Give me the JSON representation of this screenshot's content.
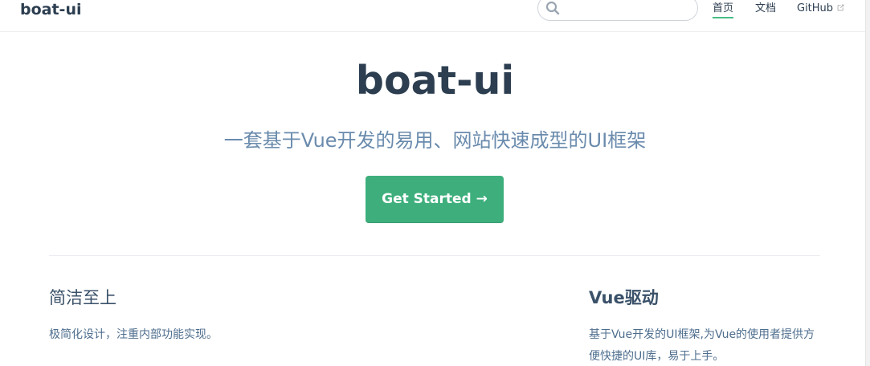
{
  "navbar": {
    "site_name": "boat-ui",
    "search": {
      "placeholder": "",
      "value": ""
    },
    "links": [
      {
        "label": "首页",
        "active": true
      },
      {
        "label": "文档",
        "active": false
      },
      {
        "label": "GitHub",
        "active": false,
        "external": true
      }
    ]
  },
  "hero": {
    "title": "boat-ui",
    "description": "一套基于Vue开发的易用、网站快速成型的UI框架",
    "action_label": "Get Started →"
  },
  "features": [
    {
      "title": "简洁至上",
      "details": "极简化设计，注重内部功能实现。"
    },
    {
      "title": "Vue驱动",
      "details": "基于Vue开发的UI框架,为Vue的使用者提供方便快捷的UI库，易于上手。"
    }
  ],
  "colors": {
    "accent": "#3eaf7c",
    "text": "#2c3e50",
    "description": "#6a8bad",
    "border": "#eaecef"
  }
}
